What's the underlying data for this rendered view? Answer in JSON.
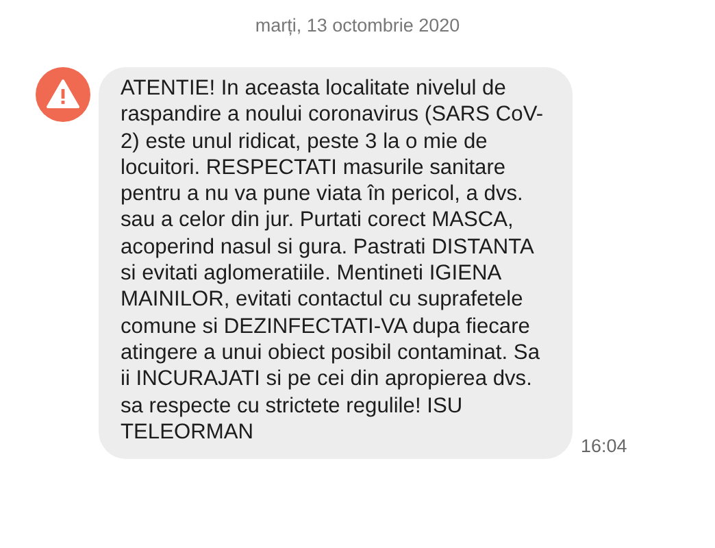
{
  "date_header": "marți, 13 octombrie 2020",
  "messages": [
    {
      "kind": "alert",
      "text": "ATENTIE! In aceasta localitate nivelul de raspandire a noului coronavirus (SARS CoV-2) este unul ridicat, peste 3 la o mie de locuitori. RESPECTATI masurile sanitare pentru a nu va pune viata în pericol, a dvs. sau a celor din jur. Purtati corect MASCA, acoperind nasul si gura. Pastrati DISTANTA si evitati aglomeratiile. Mentineti IGIENA MAINILOR, evitati contactul cu suprafetele comune si DEZINFECTATI-VA dupa fiecare atingere a unui obiect posibil contaminat. Sa ii INCURAJATI si pe cei din apropierea dvs. sa respecte cu strictete regulile! ISU TELEORMAN",
      "time": "16:04"
    }
  ]
}
